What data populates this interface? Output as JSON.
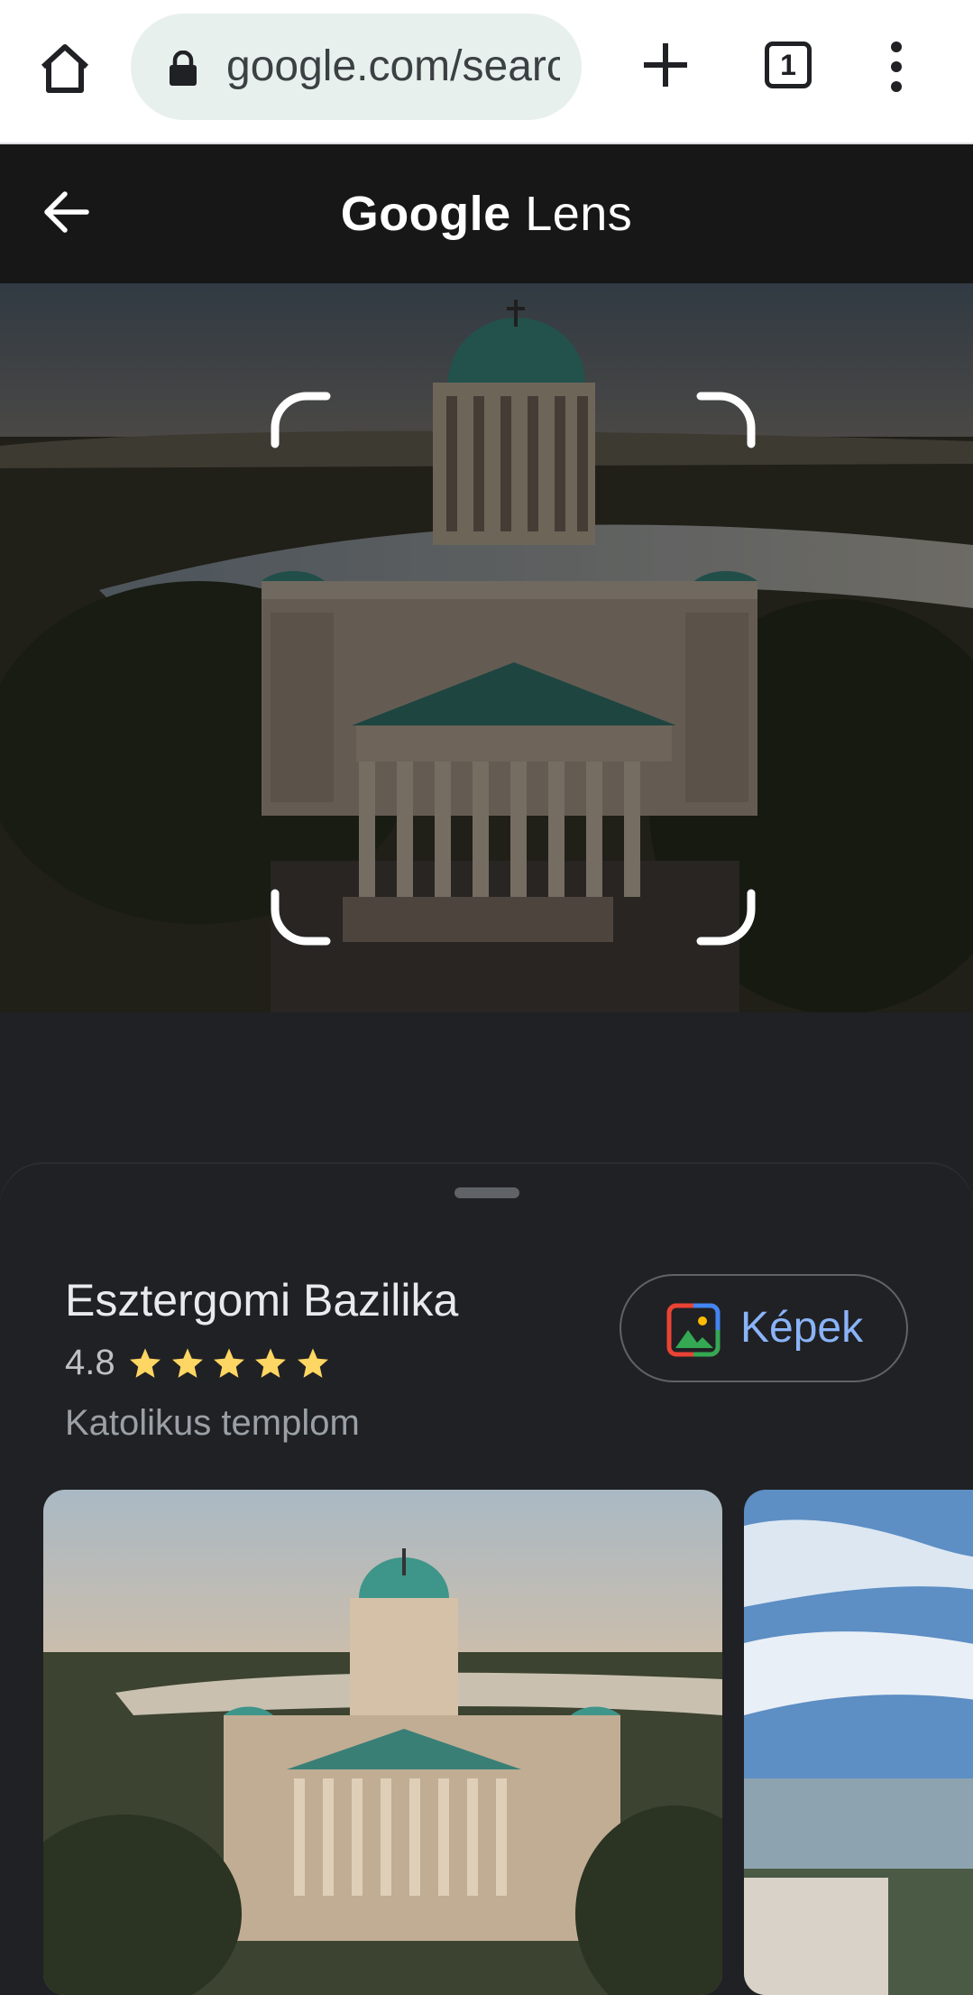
{
  "browser": {
    "url": "google.com/search",
    "tab_count": "1",
    "icons": [
      "home-icon",
      "lock-icon",
      "plus-icon",
      "tab-switcher-icon",
      "more-vert-icon"
    ]
  },
  "lens": {
    "title_google": "Google",
    "title_lens": "Lens",
    "icons": [
      "back-arrow-icon"
    ]
  },
  "result": {
    "name": "Esztergomi Bazilika",
    "rating": "4.8",
    "stars": 5,
    "category": "Katolikus templom",
    "images_button_label": "Képek",
    "accent_color": "#8ab4f8",
    "star_color": "#fdd663"
  }
}
